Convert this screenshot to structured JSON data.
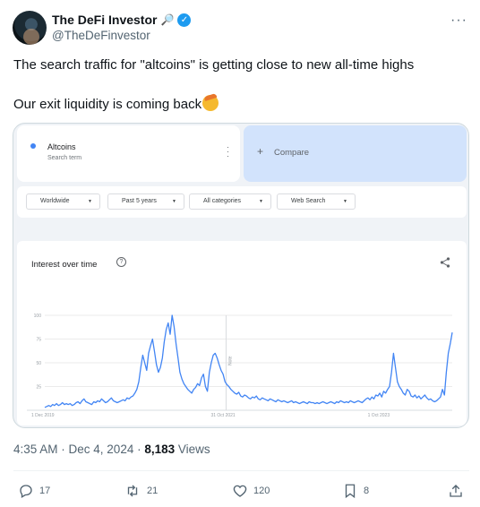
{
  "tweet": {
    "author_name": "The DeFi Investor",
    "handle": "@TheDeFinvestor",
    "text_line1": "The search traffic for \"altcoins\" is getting close to new all-time highs",
    "text_line2": "Our exit liquidity is coming back",
    "time": "4:35 AM",
    "date": "Dec 4, 2024",
    "views_count": "8,183",
    "views_label": "Views",
    "replies": "17",
    "reposts": "21",
    "likes": "120",
    "bookmarks": "8"
  },
  "trends": {
    "term": "Altcoins",
    "term_sub": "Search term",
    "compare_label": "Compare",
    "filters": [
      "Worldwide",
      "Past 5 years",
      "All categories",
      "Web Search"
    ],
    "chart_title": "Interest over time",
    "note_label": "Note"
  },
  "colors": {
    "accent": "#1d9bf0",
    "series": "#4285f4",
    "compare_bg": "#d2e3fc"
  },
  "icons": {
    "verified": "verified-badge-icon",
    "more": "more-dots-icon",
    "help": "help-circle-icon",
    "share": "share-icon",
    "reply": "reply-icon",
    "repost": "repost-icon",
    "like": "heart-icon",
    "bookmark": "bookmark-icon",
    "upload": "upload-icon"
  },
  "chart_data": {
    "type": "line",
    "title": "Interest over time",
    "ylim": [
      0,
      100
    ],
    "y_ticks": [
      "100",
      "75",
      "50",
      "25"
    ],
    "x_ticks": [
      "1 Dec 2019",
      "31 Oct 2021",
      "1 Oct 2023"
    ],
    "x_tick_positions": [
      0,
      100,
      200
    ],
    "grid": true,
    "series": [
      {
        "values": [
          3,
          4,
          5,
          4,
          6,
          5,
          7,
          5,
          6,
          8,
          6,
          7,
          6,
          7,
          5,
          6,
          8,
          9,
          7,
          10,
          12,
          9,
          8,
          7,
          6,
          9,
          8,
          10,
          9,
          12,
          10,
          8,
          9,
          11,
          13,
          10,
          9,
          8,
          9,
          10,
          11,
          10,
          13,
          12,
          14,
          15,
          18,
          22,
          30,
          45,
          58,
          50,
          42,
          60,
          68,
          75,
          62,
          48,
          40,
          45,
          55,
          72,
          85,
          92,
          80,
          100,
          88,
          70,
          55,
          40,
          33,
          28,
          25,
          22,
          20,
          18,
          22,
          24,
          28,
          26,
          34,
          38,
          25,
          20,
          40,
          50,
          58,
          60,
          55,
          48,
          42,
          38,
          30,
          27,
          25,
          22,
          20,
          18,
          17,
          19,
          15,
          14,
          16,
          15,
          13,
          12,
          14,
          13,
          15,
          12,
          11,
          13,
          12,
          11,
          10,
          12,
          11,
          10,
          9,
          11,
          10,
          9,
          10,
          9,
          8,
          9,
          10,
          8,
          9,
          8,
          7,
          8,
          9,
          8,
          7,
          9,
          8,
          8,
          7,
          8,
          7,
          8,
          9,
          8,
          7,
          8,
          9,
          8,
          7,
          9,
          8,
          10,
          9,
          8,
          9,
          8,
          10,
          9,
          8,
          9,
          10,
          9,
          8,
          10,
          12,
          13,
          11,
          14,
          12,
          16,
          15,
          18,
          14,
          20,
          18,
          22,
          25,
          40,
          60,
          45,
          30,
          25,
          22,
          18,
          16,
          22,
          20,
          15,
          14,
          16,
          13,
          15,
          12,
          14,
          16,
          13,
          11,
          12,
          10,
          9,
          10,
          12,
          14,
          22,
          16,
          40,
          60,
          70,
          82
        ]
      }
    ]
  }
}
